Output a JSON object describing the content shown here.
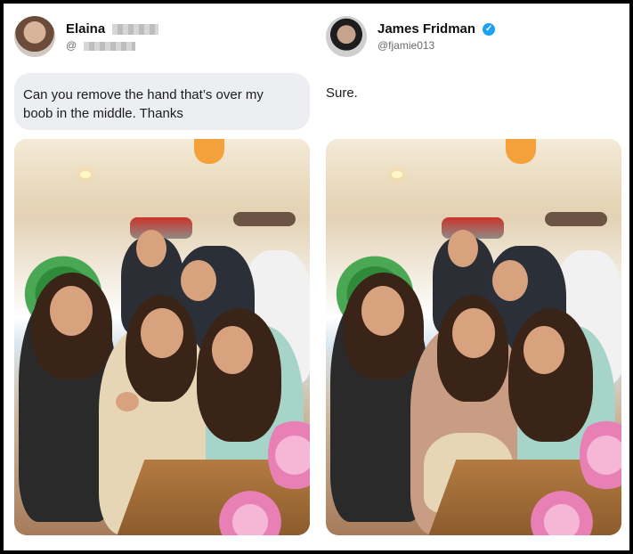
{
  "left_post": {
    "user_name": "Elaina",
    "handle_prefix": "@",
    "message": "Can you remove the hand that’s over my boob in the middle. Thanks"
  },
  "right_post": {
    "user_name": "James Fridman",
    "handle": "@fjamie013",
    "reply": "Sure."
  },
  "colors": {
    "bubble": "#eceef1",
    "verified": "#1da1f2",
    "accent_lamp": "#f5a13b"
  },
  "icons": {
    "verified": "verified-badge-icon"
  }
}
